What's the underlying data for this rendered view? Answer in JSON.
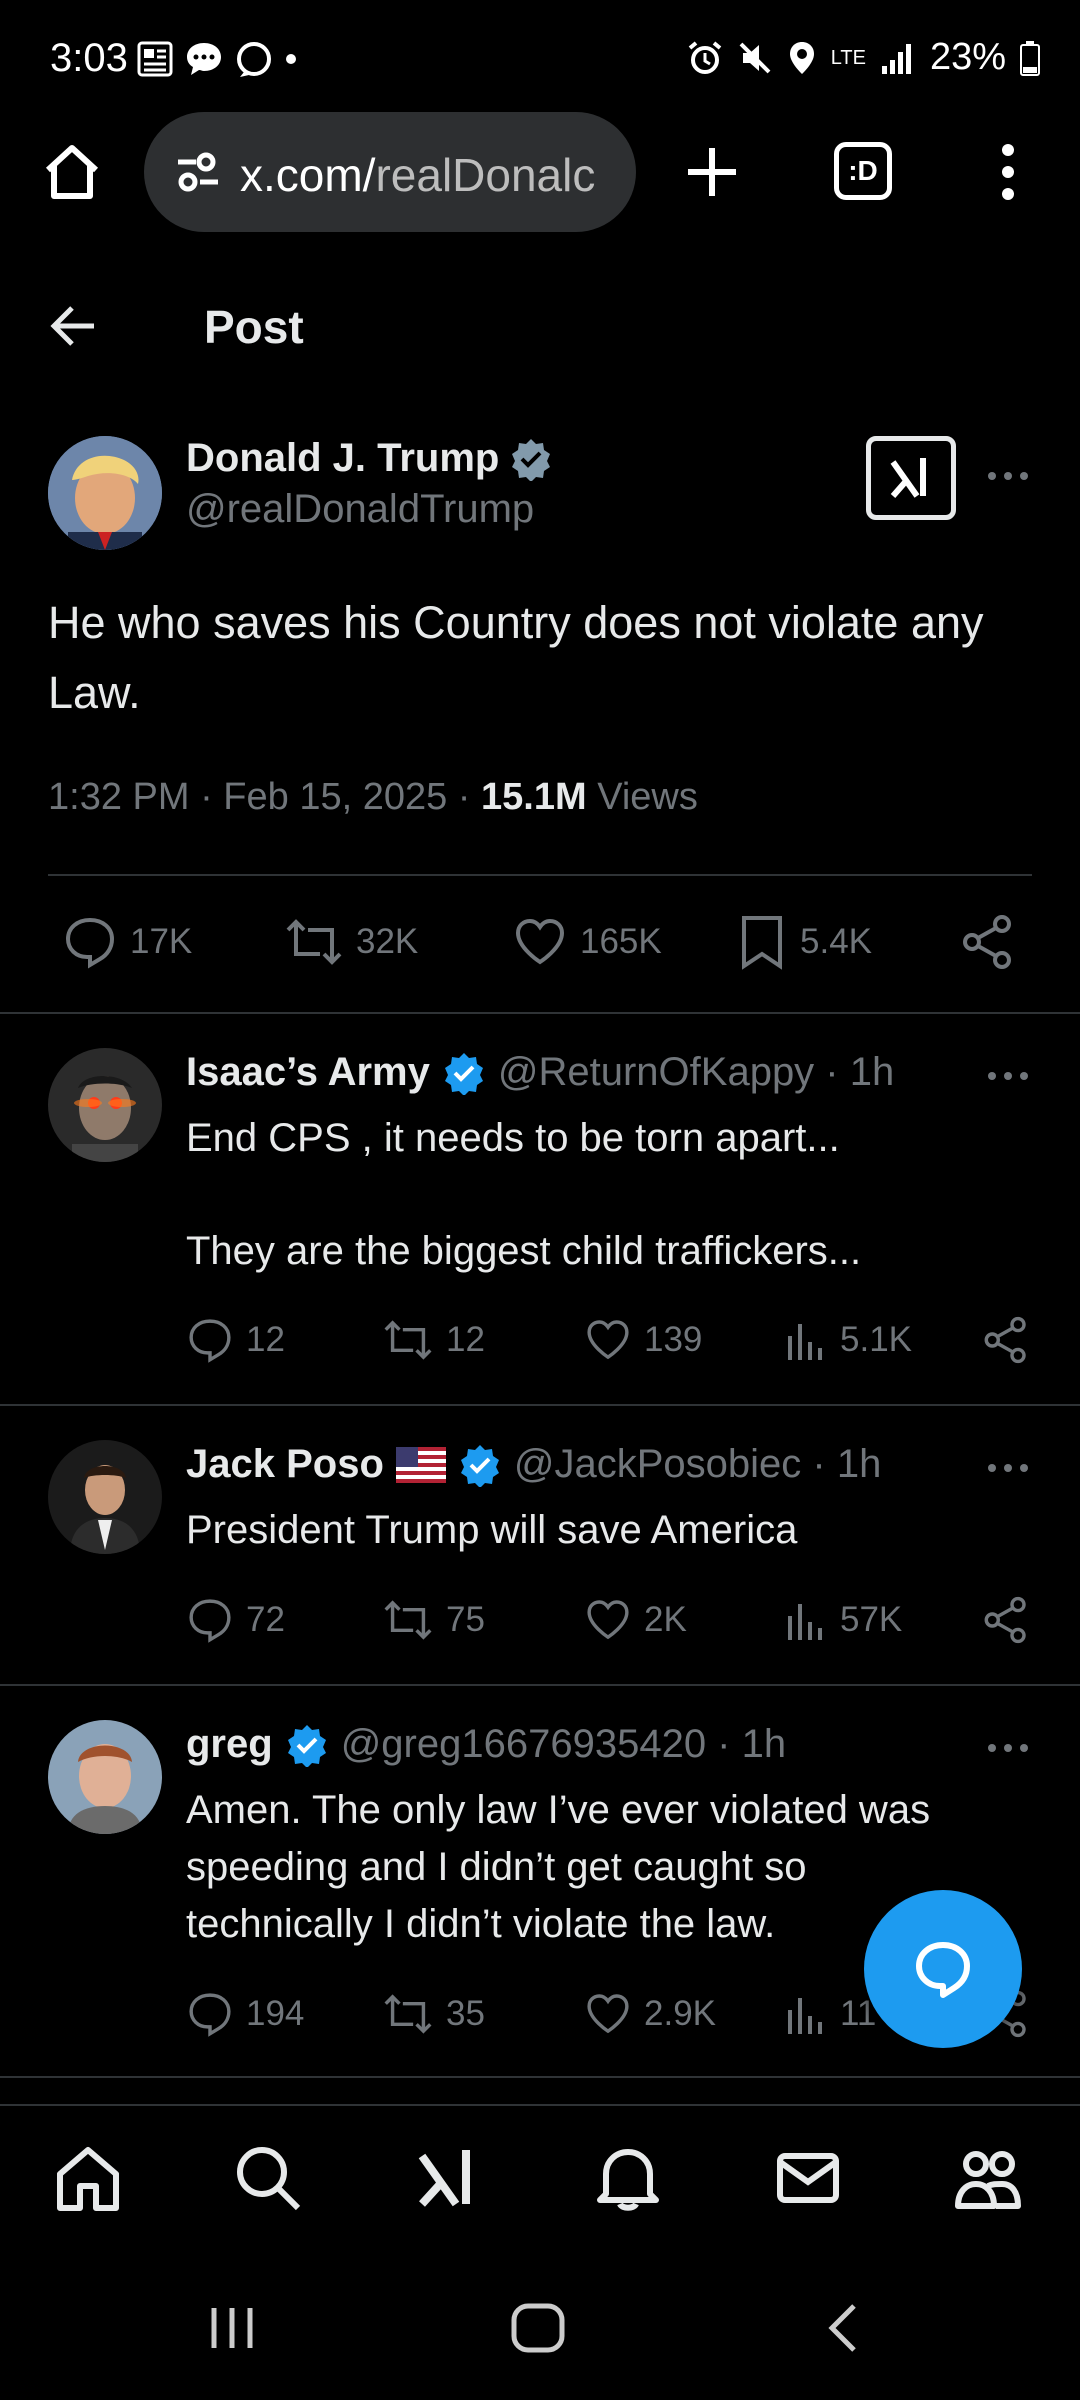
{
  "status_bar": {
    "time": "3:03",
    "battery": "23%",
    "network": "LTE"
  },
  "browser": {
    "url_domain": "x.com/",
    "url_rest": "realDonalc",
    "tab_icon_label": ":D"
  },
  "header": {
    "title": "Post"
  },
  "main_post": {
    "author_name": "Donald J. Trump",
    "author_handle": "@realDonaldTrump",
    "text": "He who saves his Country does not violate any Law.",
    "time_date": "1:32 PM · Feb 15, 2025 · ",
    "views_count": "15.1M",
    "views_label": " Views",
    "stats": {
      "replies": "17K",
      "reposts": "32K",
      "likes": "165K",
      "bookmarks": "5.4K"
    }
  },
  "replies": [
    {
      "name": "Isaac’s Army",
      "handle_time": "@ReturnOfKappy · 1h",
      "text_line1": "End CPS , it needs to be torn apart...",
      "text_line2": "They are the biggest child traffickers...",
      "replies": "12",
      "reposts": "12",
      "likes": "139",
      "views": "5.1K"
    },
    {
      "name": "Jack Poso",
      "handle_time": "@JackPosobiec · 1h",
      "text_line1": "President Trump will save America",
      "replies": "72",
      "reposts": "75",
      "likes": "2K",
      "views": "57K"
    },
    {
      "name": "greg",
      "handle_time": "@greg16676935420 · 1h",
      "text_line1": "Amen. The only law I’ve ever violated was",
      "text_line2": "speeding and I didn’t get caught so",
      "text_line3": "technically I didn’t violate the law.",
      "replies": "194",
      "reposts": "35",
      "likes": "2.9K",
      "views": "11"
    }
  ],
  "colors": {
    "accent": "#1d9bf0",
    "background": "#000000",
    "muted": "#71767b",
    "divider": "#2f3336"
  },
  "icons": {
    "bottom_nav": [
      "home-icon",
      "search-icon",
      "grok-icon",
      "notifications-icon",
      "messages-icon",
      "communities-icon"
    ]
  }
}
